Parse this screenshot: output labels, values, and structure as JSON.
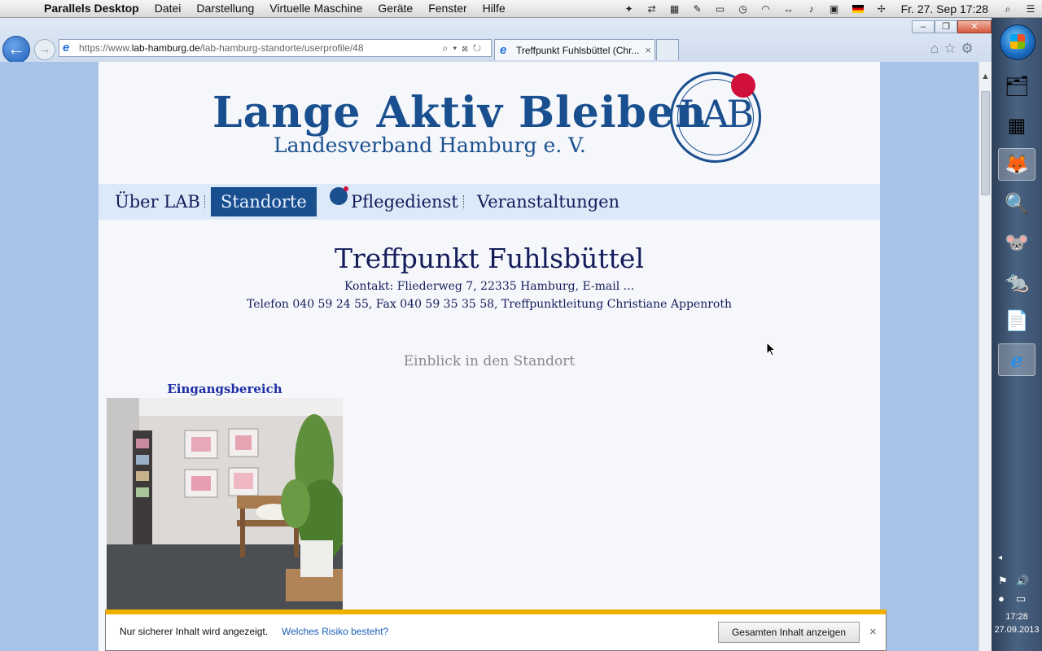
{
  "menubar": {
    "apple": "",
    "app_name": "Parallels Desktop",
    "menus": [
      "Datei",
      "Darstellung",
      "Virtuelle Maschine",
      "Geräte",
      "Fenster",
      "Hilfe"
    ],
    "clock": "Fr. 27. Sep  17:28"
  },
  "browser": {
    "url_prefix": "https://www.",
    "url_domain": "lab-hamburg.de",
    "url_path": "/lab-hamburg-standorte/userprofile/48",
    "address_tools": "⌕▾⊠↻",
    "tab_title": "Treffpunkt Fuhlsbüttel (Chr...",
    "tab_close": "×",
    "window_min": "–",
    "window_restore": "❐",
    "window_close": "✕",
    "home_icon": "⌂",
    "favorites_icon": "☆",
    "tools_icon": "⚙"
  },
  "site": {
    "logo_title": "Lange Aktiv Bleiben",
    "logo_subtitle": "Landesverband Hamburg e. V.",
    "logo_seal": "LAB",
    "nav": [
      {
        "label": "Über LAB"
      },
      {
        "label": "Standorte"
      },
      {
        "label": "Pflegedienst"
      },
      {
        "label": "Veranstaltungen"
      }
    ],
    "nav_active_index": 1
  },
  "content": {
    "heading": "Treffpunkt Fuhlsbüttel",
    "contact_line1": "Kontakt: Fliederweg 7, 22335 Hamburg, E-mail ...",
    "contact_line2": "Telefon 040 59 24 55, Fax 040 59 35 35 58, Treffpunktleitung Christiane Appenroth",
    "section_title": "Einblick in den Standort",
    "photo_caption": "Eingangsbereich"
  },
  "security_bar": {
    "message": "Nur sicherer Inhalt wird angezeigt.",
    "risk_link": "Welches Risiko besteht?",
    "show_all_button": "Gesamten Inhalt anzeigen",
    "close": "×"
  },
  "taskbar": {
    "time": "17:28",
    "date": "27.09.2013",
    "items": [
      "explorer-icon",
      "control-panel-icon",
      "firefox-icon",
      "search-icon",
      "app-icon-1",
      "app-icon-2",
      "notepad-icon",
      "internet-explorer-icon"
    ]
  },
  "colors": {
    "brand_blue": "#1a4f8f",
    "accent_red": "#d0103a",
    "security_bar": "#f0b000"
  }
}
